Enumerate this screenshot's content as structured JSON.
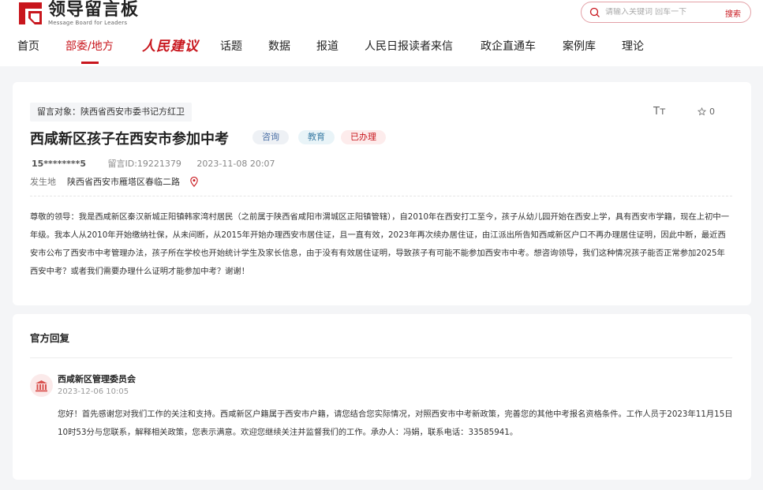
{
  "site": {
    "logo_title": "领导留言板",
    "logo_subtitle": "Message Board for Leaders",
    "search_placeholder": "请输入关键词 回车一下",
    "search_button": "搜索"
  },
  "nav": {
    "items": [
      "首页",
      "部委/地方",
      "人民建议",
      "话题",
      "数据",
      "报道",
      "人民日报读者来信",
      "政企直通车",
      "案例库",
      "理论"
    ],
    "active": "部委/地方"
  },
  "message": {
    "target": "留言对象：陕西省西安市委书记方红卫",
    "font_toggle": "Tт",
    "favorite_count": "0",
    "title": "西咸新区孩子在西安市参加中考",
    "tags": [
      "咨询",
      "教育",
      "已办理"
    ],
    "author": "15********5",
    "message_id": "留言ID:19221379",
    "datetime": "2023-11-08 20:07",
    "location_label": "发生地",
    "location_value": "陕西省西安市雁塔区春临二路",
    "body": "尊敬的领导：我是西咸新区秦汉新城正阳镇韩家湾村居民（之前属于陕西省咸阳市渭城区正阳镇管辖），自2010年在西安打工至今，孩子从幼儿园开始在西安上学，具有西安市学籍，现在上初中一年级。我本人从2010年开始缴纳社保，从未间断，从2015年开始办理西安市居住证，且一直有效，2023年再次续办居住证，由江派出所告知西咸新区户口不再办理居住证明，因此中断，最近西安市公布了西安市中考管理办法，孩子所在学校也开始统计学生及家长信息，由于没有有效居住证明，导致孩子有可能不能参加西安市中考。想咨询领导，我们这种情况孩子能否正常参加2025年西安中考？或者我们需要办理什么证明才能参加中考？谢谢！"
  },
  "reply": {
    "heading": "官方回复",
    "org_name": "西咸新区管理委员会",
    "datetime": "2023-12-06 10:05",
    "body": "您好！首先感谢您对我们工作的关注和支持。西咸新区户籍属于西安市户籍，请您结合您实际情况，对照西安市中考新政策，完善您的其他中考报名资格条件。工作人员于2023年11月15日10时53分与您联系，解释相关政策，您表示满意。欢迎您继续关注并监督我们的工作。承办人：冯娟，联系电话：33585941。"
  },
  "colors": {
    "brand_red": "#c8161d",
    "page_bg": "#f4f5f7"
  }
}
